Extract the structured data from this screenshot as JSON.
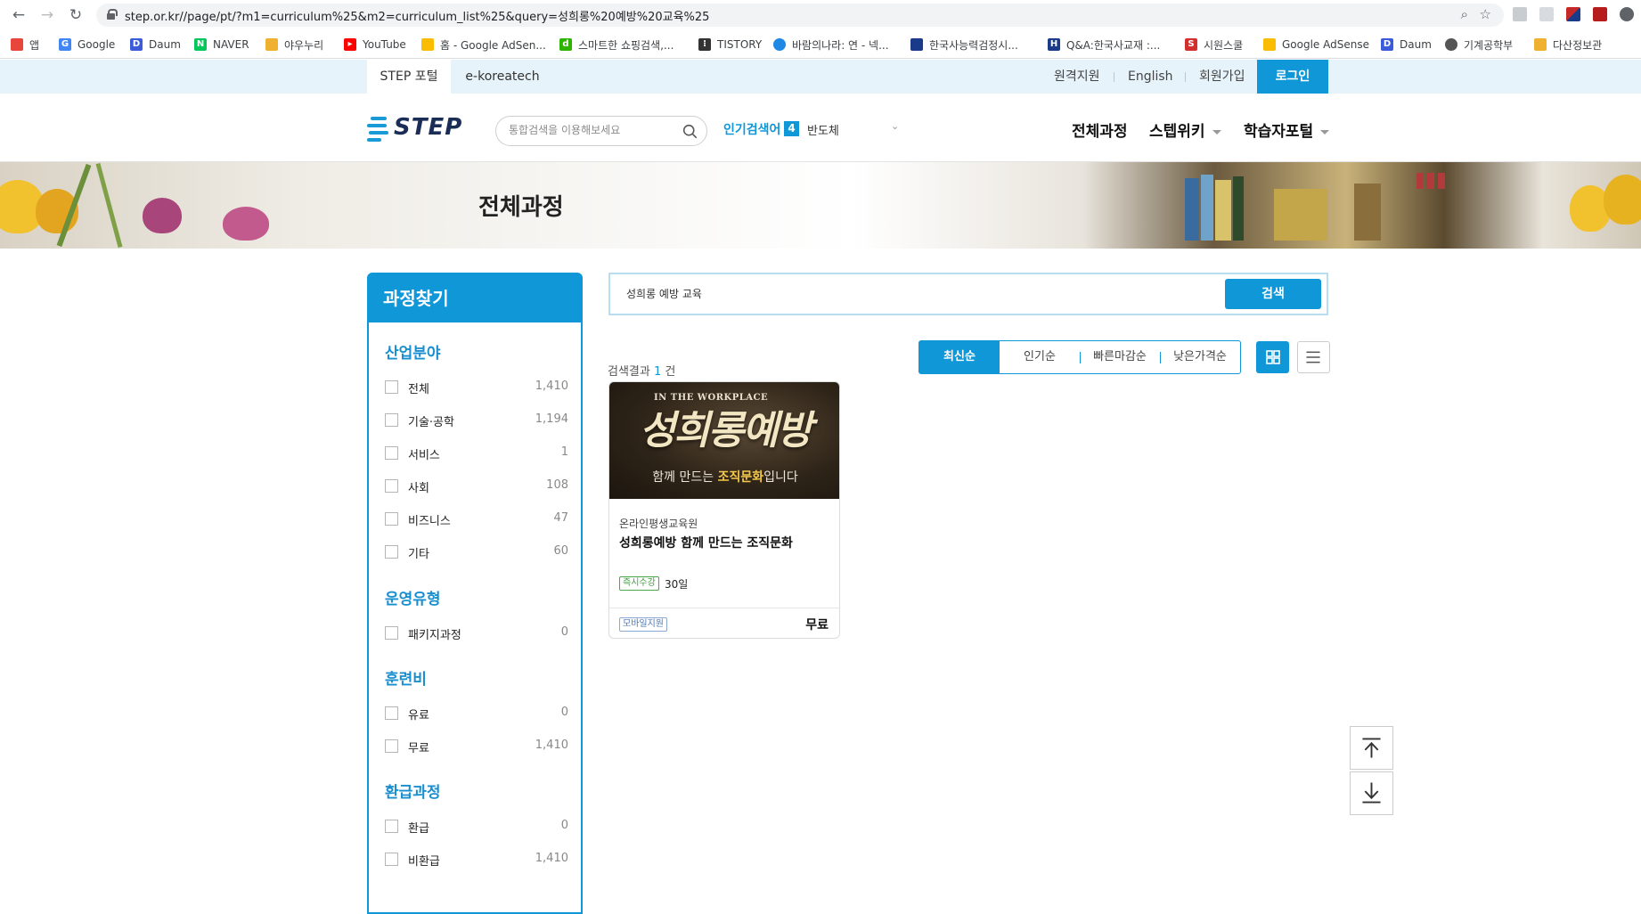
{
  "browser": {
    "url": "step.or.kr//page/pt/?m1=curriculum%25&m2=curriculum_list%25&query=성희롱%20예방%20교육%25",
    "bookmarks": [
      {
        "label": "앱",
        "color": "#e8453c"
      },
      {
        "label": "Google",
        "color": "#4285f4"
      },
      {
        "label": "Daum",
        "color": "#3b5bdb"
      },
      {
        "label": "NAVER",
        "color": "#03c75a"
      },
      {
        "label": "야우누리",
        "color": "#f0b030"
      },
      {
        "label": "YouTube",
        "color": "#ff0000"
      },
      {
        "label": "홈 - Google AdSen...",
        "color": "#fbbc04"
      },
      {
        "label": "스마트한 쇼핑검색,...",
        "color": "#2db400"
      },
      {
        "label": "TISTORY",
        "color": "#333333"
      },
      {
        "label": "바람의나라: 연 - 넥...",
        "color": "#1e88e5"
      },
      {
        "label": "한국사능력검정시...",
        "color": "#1a3a8a"
      },
      {
        "label": "Q&A:한국사교재 :...",
        "color": "#1a3a8a"
      },
      {
        "label": "시원스쿨",
        "color": "#d32f2f"
      },
      {
        "label": "Google AdSense",
        "color": "#fbbc04"
      },
      {
        "label": "Daum",
        "color": "#3b5bdb"
      },
      {
        "label": "기계공학부",
        "color": "#555555"
      },
      {
        "label": "다산정보관",
        "color": "#f0b030"
      }
    ]
  },
  "utility": {
    "tabs": [
      "STEP 포털",
      "e-koreatech"
    ],
    "links": [
      "원격지원",
      "English",
      "회원가입"
    ],
    "login": "로그인"
  },
  "header": {
    "logo": "STEP",
    "search_placeholder": "통합검색을 이용해보세요",
    "popular_label": "인기검색어",
    "popular_rank": "4",
    "popular_term": "반도체",
    "nav": [
      "전체과정",
      "스텝위키",
      "학습자포털"
    ]
  },
  "banner": {
    "title": "전체과정"
  },
  "sidebar": {
    "title": "과정찾기",
    "groups": [
      {
        "title": "산업분야",
        "items": [
          {
            "label": "전체",
            "count": "1,410"
          },
          {
            "label": "기술·공학",
            "count": "1,194"
          },
          {
            "label": "서비스",
            "count": "1"
          },
          {
            "label": "사회",
            "count": "108"
          },
          {
            "label": "비즈니스",
            "count": "47"
          },
          {
            "label": "기타",
            "count": "60"
          }
        ]
      },
      {
        "title": "운영유형",
        "items": [
          {
            "label": "패키지과정",
            "count": "0"
          }
        ]
      },
      {
        "title": "훈련비",
        "items": [
          {
            "label": "유료",
            "count": "0"
          },
          {
            "label": "무료",
            "count": "1,410"
          }
        ]
      },
      {
        "title": "환급과정",
        "items": [
          {
            "label": "환급",
            "count": "0"
          },
          {
            "label": "비환급",
            "count": "1,410"
          }
        ]
      }
    ]
  },
  "main": {
    "search_value": "성희롱 예방 교육",
    "search_button": "검색",
    "sort": [
      "최신순",
      "인기순",
      "빠른마감순",
      "낮은가격순"
    ],
    "result_prefix": "검색결과",
    "result_count": "1",
    "result_suffix": "건"
  },
  "card": {
    "thumb_small": "IN THE WORKPLACE",
    "thumb_big": "성희롱예방",
    "thumb_sub_a": "함께 만드는 ",
    "thumb_sub_b": "조직문화",
    "thumb_sub_c": "입니다",
    "org": "온라인평생교육원",
    "title": "성희롱예방 함께 만드는 조직문화",
    "badge_instant": "즉시수강",
    "days": "30일",
    "badge_mobile": "모바일지원",
    "price": "무료"
  },
  "colors": {
    "accent": "#0f97d8",
    "accent_light": "#e6f3fb"
  }
}
